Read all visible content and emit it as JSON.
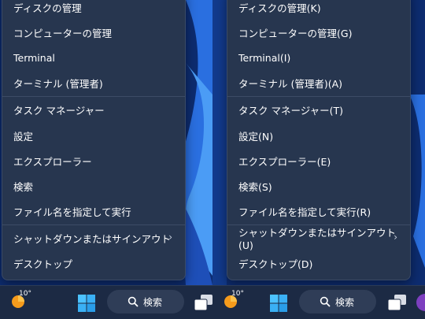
{
  "panels": [
    {
      "items": [
        {
          "label": "ディスクの管理"
        },
        {
          "label": "コンピューターの管理"
        },
        {
          "label": "Terminal"
        },
        {
          "label": "ターミナル (管理者)"
        },
        {
          "label": "タスク マネージャー"
        },
        {
          "label": "設定"
        },
        {
          "label": "エクスプローラー"
        },
        {
          "label": "検索"
        },
        {
          "label": "ファイル名を指定して実行"
        },
        {
          "label": "シャットダウンまたはサインアウト",
          "submenu_arrow": "›"
        },
        {
          "label": "デスクトップ"
        }
      ],
      "taskbar": {
        "temperature": "10°",
        "search_label": "検索"
      }
    },
    {
      "items": [
        {
          "label": "ディスクの管理(K)"
        },
        {
          "label": "コンピューターの管理(G)"
        },
        {
          "label": "Terminal(I)"
        },
        {
          "label": "ターミナル (管理者)(A)"
        },
        {
          "label": "タスク マネージャー(T)"
        },
        {
          "label": "設定(N)"
        },
        {
          "label": "エクスプローラー(E)"
        },
        {
          "label": "検索(S)"
        },
        {
          "label": "ファイル名を指定して実行(R)"
        },
        {
          "label": "シャットダウンまたはサインアウト(U)",
          "submenu_arrow": "›"
        },
        {
          "label": "デスクトップ(D)"
        }
      ],
      "taskbar": {
        "temperature": "10°",
        "search_label": "検索"
      }
    }
  ],
  "colors": {
    "menu_background": "#27364f",
    "taskbar_background": "#1c2a44",
    "wallpaper_blue": "#1c63d6",
    "start_icon": "#4cc2ff",
    "weather_icon": "#f59b1c"
  },
  "icons": [
    "weather-sun-icon",
    "windows-start-icon",
    "search-icon",
    "task-view-icon"
  ]
}
